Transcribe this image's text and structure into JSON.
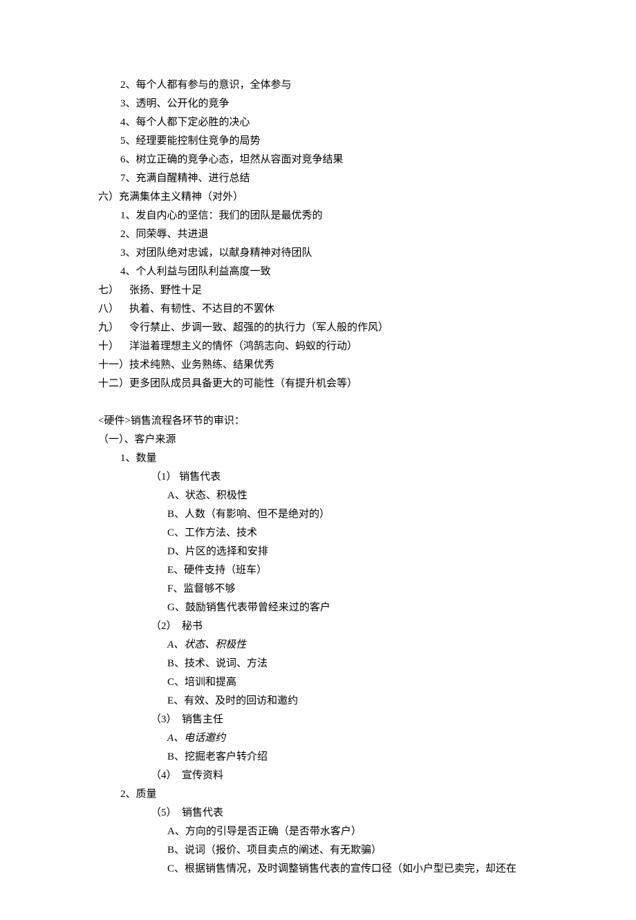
{
  "section5": {
    "items": [
      "2、每个人都有参与的意识，全体参与",
      "3、透明、公开化的竞争",
      "4、每个人都下定必胜的决心",
      "5、经理要能控制住竞争的局势",
      "6、树立正确的竞争心态，坦然从容面对竞争结果",
      "7、充满自醒精神、进行总结"
    ]
  },
  "section6": {
    "title": "六）充满集体主义精神（对外）",
    "items": [
      "1、发自内心的坚信：我们的团队是最优秀的",
      "2、同荣辱、共进退",
      "3、对团队绝对忠诚，以献身精神对待团队",
      "4、个人利益与团队利益高度一致"
    ]
  },
  "section7": "七）    张扬、野性十足",
  "section8": "八）    执着、有韧性、不达目的不罢休",
  "section9": "九）    令行禁止、步调一致、超强的的执行力（军人般的作风）",
  "section10": "十）    洋溢着理想主义的情怀（鸿鹄志向、蚂蚁的行动）",
  "section11": "十一）技术纯熟、业务熟练、结果优秀",
  "section12": "十二）更多团队成员具备更大的可能性（有提升机会等）",
  "hardware": {
    "title": "<硬件>销售流程各环节的审识：",
    "part1": {
      "title": "（一）、客户来源",
      "sub1": {
        "title": "1、数量",
        "g1": {
          "title": "（1） 销售代表",
          "items": [
            "A、状态、积极性",
            "B、人数（有影响、但不是绝对的）",
            "C、工作方法、技术",
            "D、片区的选择和安排",
            "E、硬件支持（班车）",
            "F、监督够不够",
            "G、鼓励销售代表带曾经来过的客户"
          ]
        },
        "g2": {
          "title": "（2）  秘书",
          "items": [
            "A、状态、积极性",
            "B、技术、说词、方法",
            "C、培训和提高",
            "E、有效、及时的回访和邀约"
          ]
        },
        "g3": {
          "title": "（3）  销售主任",
          "items": [
            "A、电话邀约",
            "B、挖掘老客户转介绍"
          ]
        },
        "g4": {
          "title": "（4）  宣传资料"
        }
      },
      "sub2": {
        "title": "2、质量",
        "g5": {
          "title": "（5）  销售代表",
          "items": [
            "A、方向的引导是否正确（是否带水客户）",
            "B、说词（报价、项目卖点的阐述、有无欺骗）",
            "C、根据销售情况，及时调整销售代表的宣传口径（如小户型已卖完，却还在"
          ]
        }
      }
    }
  }
}
